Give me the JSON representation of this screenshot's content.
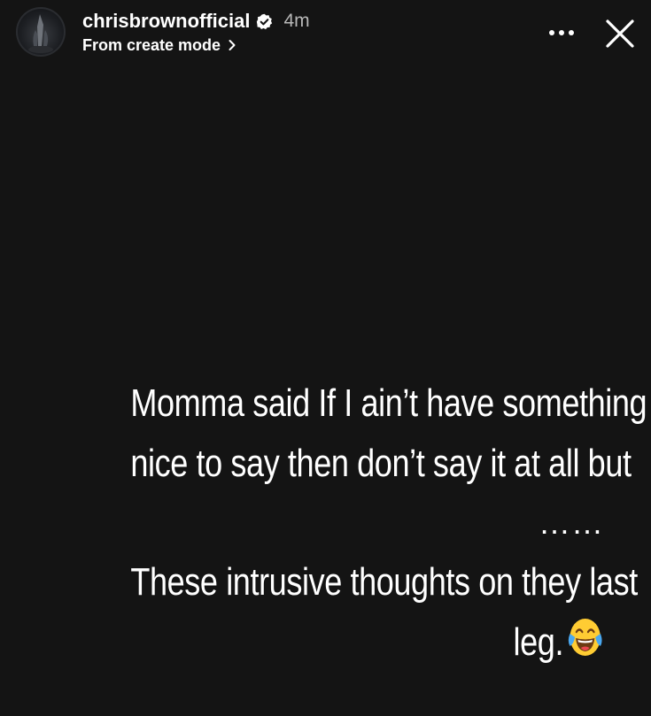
{
  "header": {
    "username": "chrisbrownofficial",
    "time": "4m",
    "subtitle": "From create mode",
    "icons": {
      "avatar": "profile-avatar",
      "verified": "verified-badge-icon",
      "subtitle_chevron": "chevron-right-icon",
      "more": "more-options-icon",
      "close": "close-icon"
    }
  },
  "story": {
    "text_lines": [
      "Momma said If I ain’t have something",
      "nice to say then don’t say it at all but",
      "……",
      "These intrusive thoughts on they last",
      "leg."
    ],
    "emoji": "face-with-tears-of-joy-icon"
  },
  "colors": {
    "background": "#141414",
    "text": "#ffffff",
    "time_text": "#b8b8b8",
    "emoji_face": "#ffcc33",
    "emoji_tears": "#4aa8f0"
  }
}
